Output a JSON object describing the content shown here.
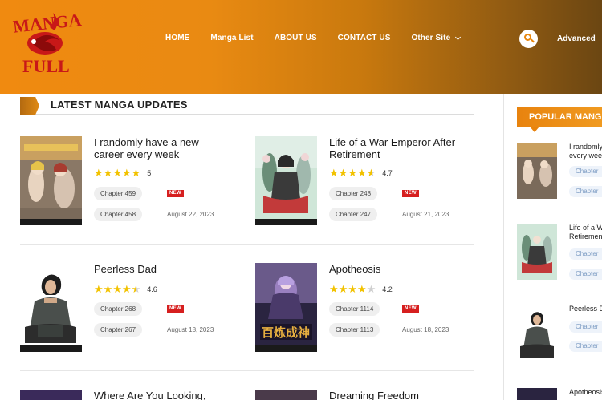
{
  "brand": {
    "logo_line1": "MANGA",
    "logo_line2": "FULL",
    "primary_color": "#ee8a10",
    "accent_red": "#d61f1f"
  },
  "nav": {
    "items": [
      "HOME",
      "Manga List",
      "ABOUT US",
      "CONTACT US",
      "Other Site"
    ],
    "advanced_label": "Advanced"
  },
  "latest": {
    "title": "LATEST MANGA UPDATES",
    "items": [
      {
        "title_line1": "I randomly have a new",
        "title_line2": "career every week",
        "rating": "5",
        "chapter_new": "Chapter 459",
        "chapter_prev": "Chapter 458",
        "badge": "NEW",
        "date": "August 22, 2023",
        "stars": 5
      },
      {
        "title_line1": "Life of a War Emperor After",
        "title_line2": "Retirement",
        "rating": "4.7",
        "chapter_new": "Chapter 248",
        "chapter_prev": "Chapter 247",
        "badge": "NEW",
        "date": "August 21, 2023",
        "stars": 4.7
      },
      {
        "title_line1": "Peerless Dad",
        "title_line2": "",
        "rating": "4.6",
        "chapter_new": "Chapter 268",
        "chapter_prev": "Chapter 267",
        "badge": "NEW",
        "date": "August 18, 2023",
        "stars": 4.6
      },
      {
        "title_line1": "Apotheosis",
        "title_line2": "",
        "rating": "4.2",
        "chapter_new": "Chapter 1114",
        "chapter_prev": "Chapter 1113",
        "badge": "NEW",
        "date": "August 18, 2023",
        "stars": 4.2
      },
      {
        "title_line1": "Where Are You Looking,",
        "title_line2": ""
      },
      {
        "title_line1": "Dreaming Freedom",
        "title_line2": ""
      }
    ]
  },
  "popular": {
    "title": "POPULAR MANGA",
    "items": [
      {
        "line1": "I randomly",
        "line2": "every week",
        "chip1": "Chapter",
        "chip2": "Chapter"
      },
      {
        "line1": "Life of a War",
        "line2": "Retirement",
        "chip1": "Chapter",
        "chip2": "Chapter"
      },
      {
        "line1": "Peerless Dad",
        "line2": "",
        "chip1": "Chapter",
        "chip2": "Chapter"
      },
      {
        "line1": "Apotheosis",
        "line2": ""
      }
    ]
  }
}
